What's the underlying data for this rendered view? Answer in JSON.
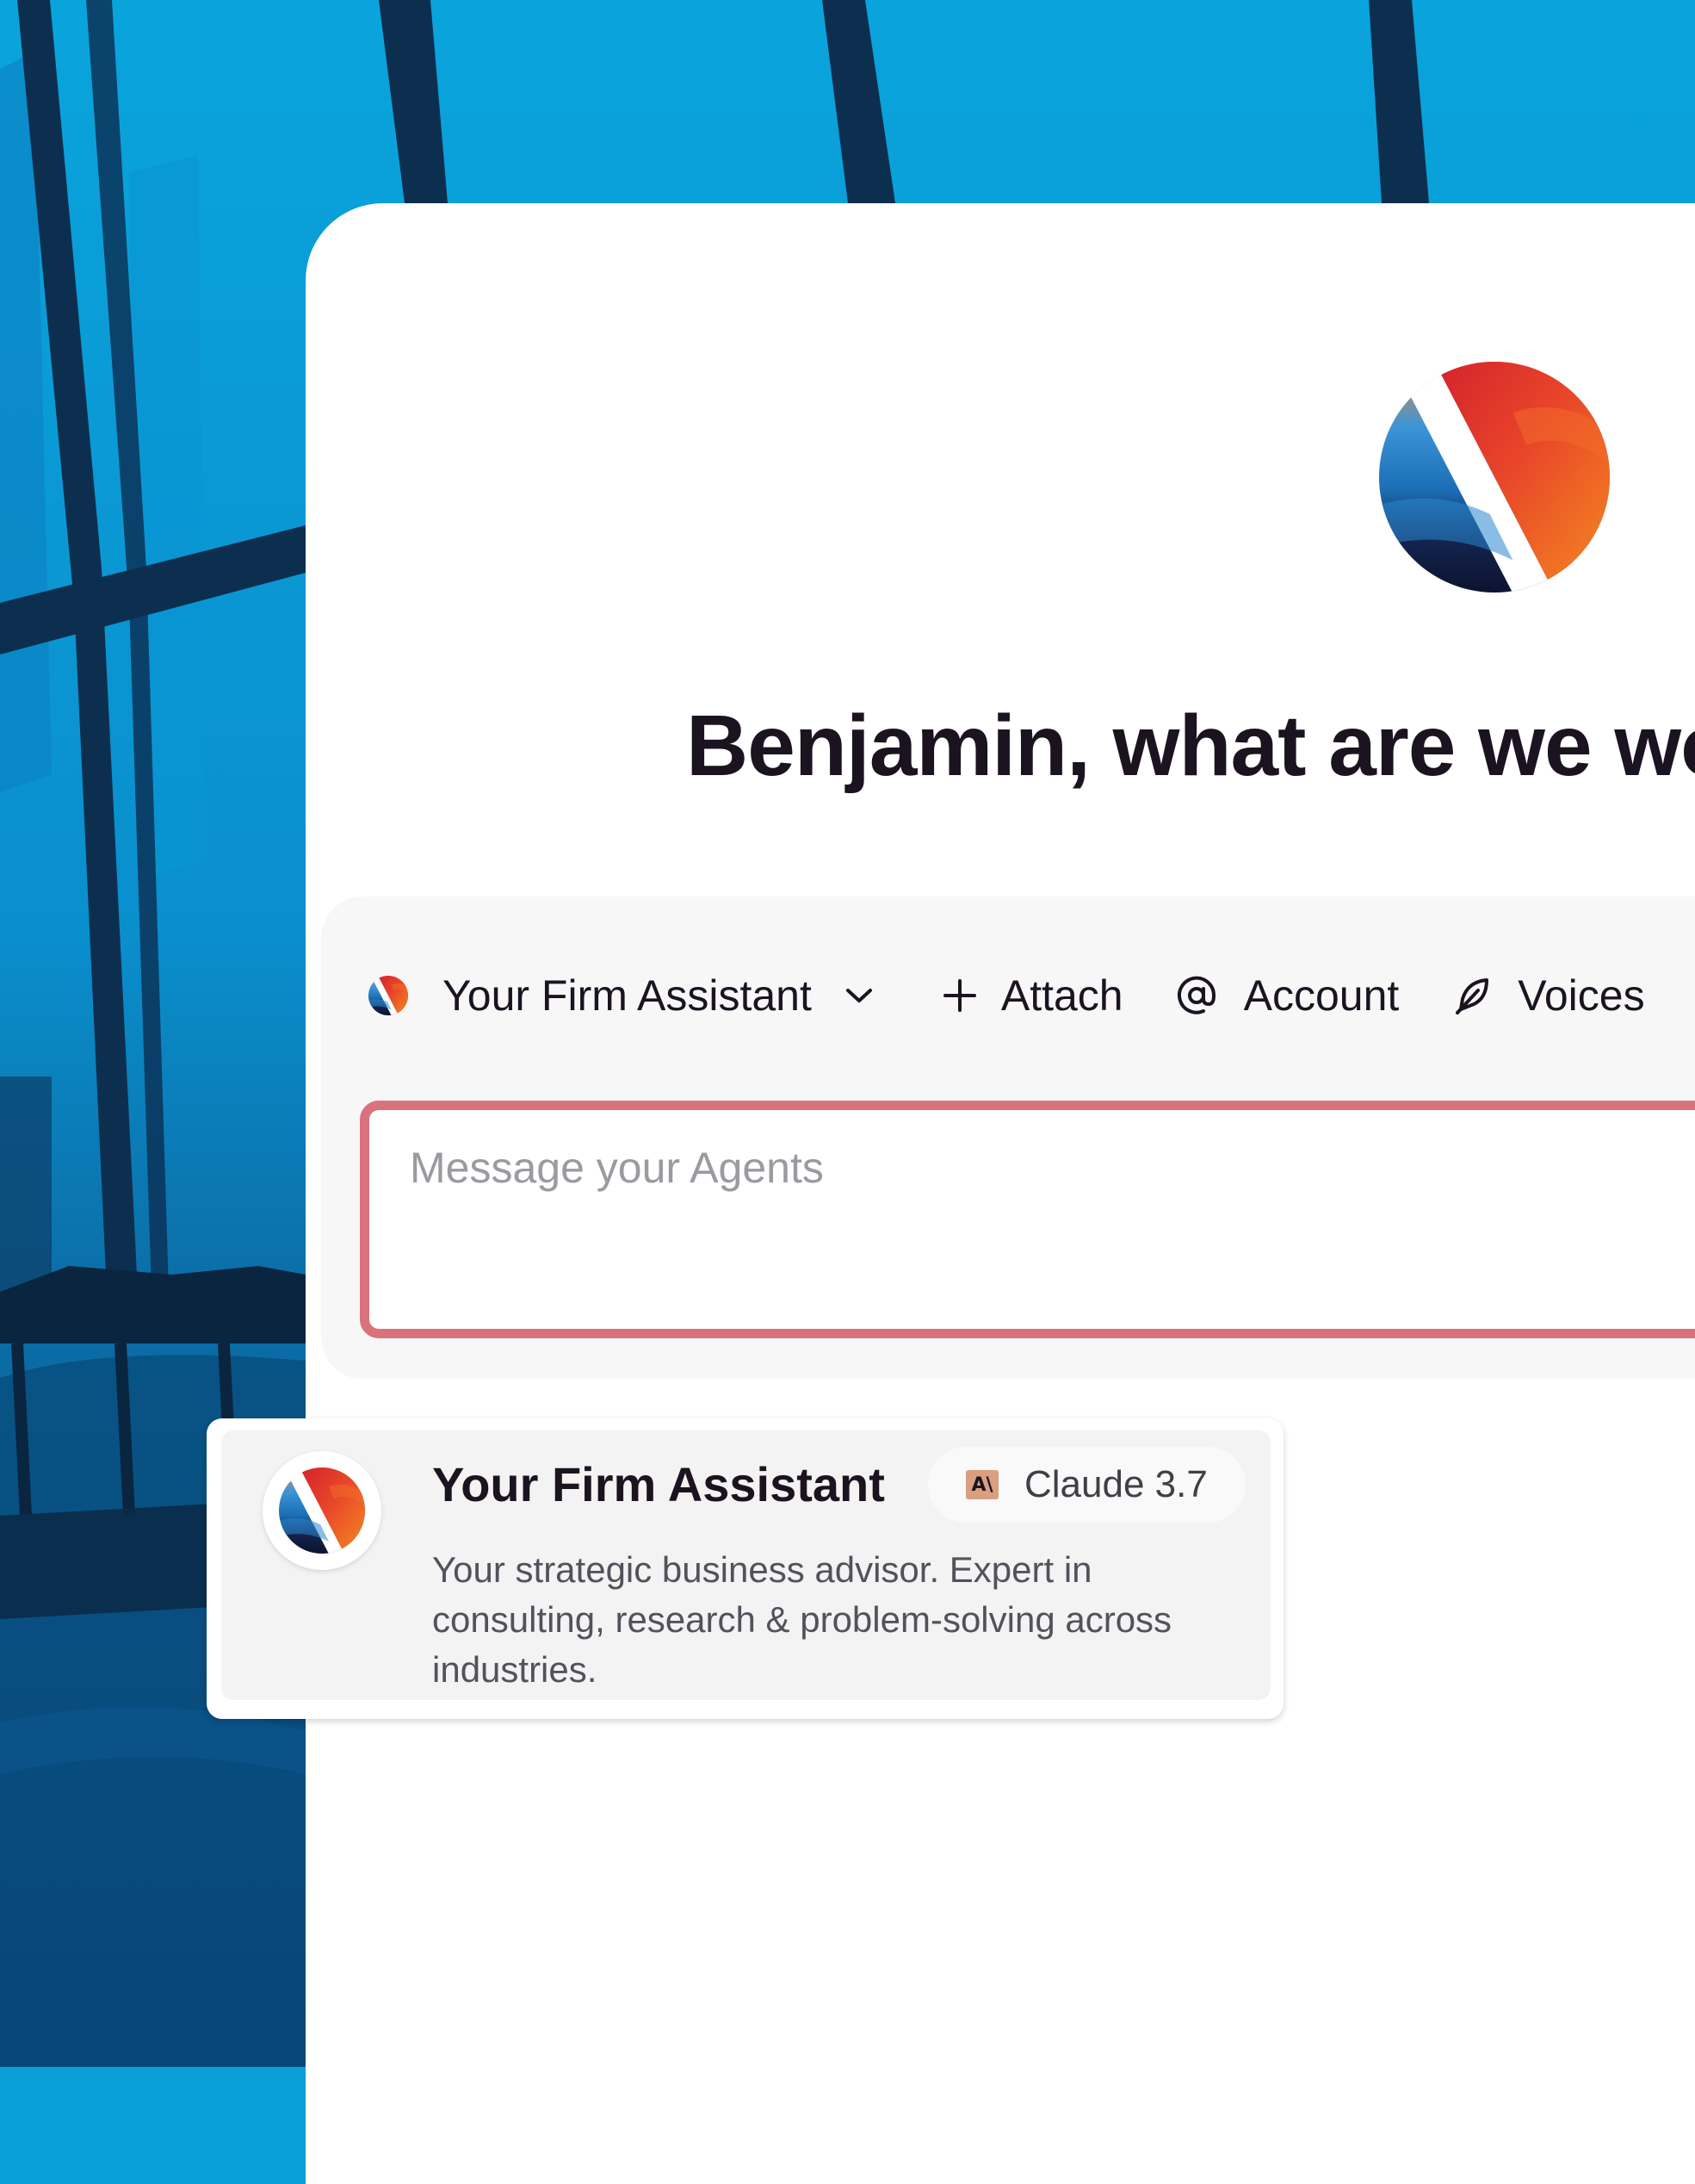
{
  "greeting": {
    "headline": "Benjamin, what are we wo"
  },
  "toolbar": {
    "agent_select_label": "Your Firm Assistant",
    "attach_label": "Attach",
    "account_label": "Account",
    "voice_label": "Voices"
  },
  "composer": {
    "placeholder": "Message your Agents",
    "value": ""
  },
  "agent_card": {
    "name": "Your Firm Assistant",
    "model_badge_icon_text": "A\\",
    "model": "Claude 3.7",
    "description": "Your strategic business advisor. Expert in consulting, research & problem-solving across industries."
  },
  "icons": [
    "brand-logo-icon",
    "chevron-down-icon",
    "plus-icon",
    "at-sign-icon",
    "feather-icon",
    "anthropic-icon"
  ],
  "colors": {
    "accent_border": "#d9727b",
    "logo_red": "#e23a2d",
    "logo_orange": "#f07a1e",
    "logo_blue": "#1a72b8",
    "logo_navy": "#101935",
    "background_blue": "#0a9ed6"
  }
}
